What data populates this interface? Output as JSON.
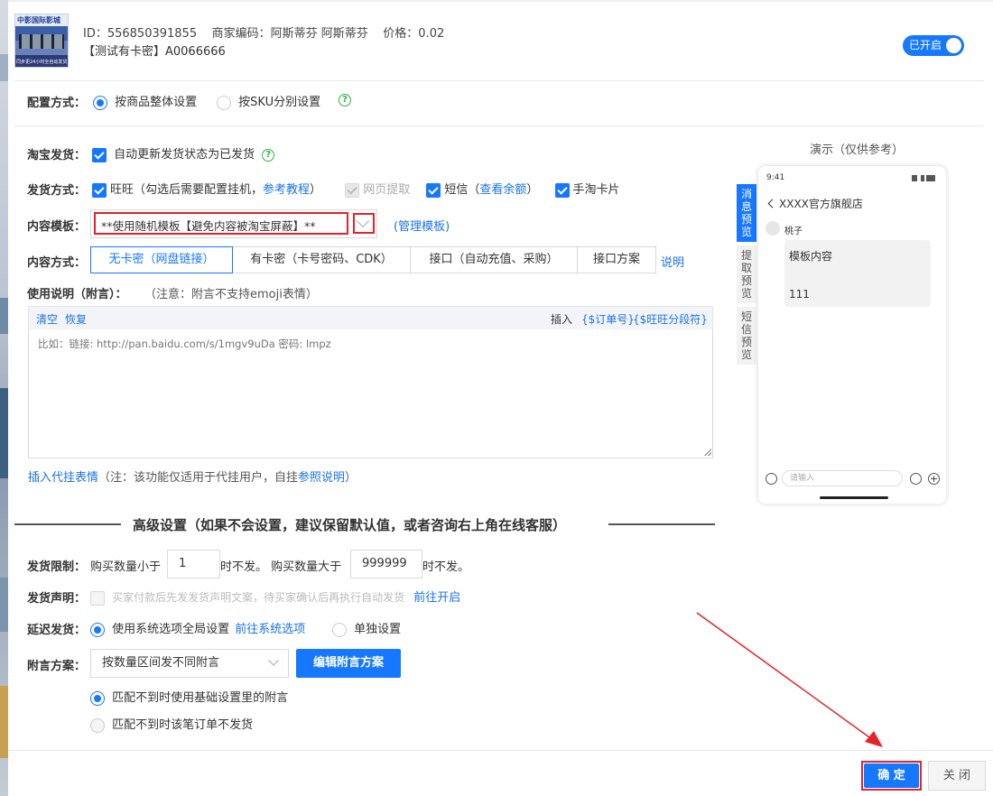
{
  "product": {
    "id_line": "ID：556850391855    商家编码：阿斯蒂芬 阿斯蒂芬    价格：0.02",
    "name": "【测试有卡密】A0066666",
    "thumb_title": "中影国际影城",
    "thumb_sub": "同步更24小时全自动发货",
    "toggle_label": "已开启"
  },
  "config": {
    "label": "配置方式：",
    "options": [
      "按商品整体设置",
      "按SKU分别设置"
    ]
  },
  "taobao": {
    "label": "淘宝发货：",
    "text": "自动更新发货状态为已发货"
  },
  "ship": {
    "label": "发货方式：",
    "wangwang": "旺旺（勾选后需要配置挂机，",
    "wangwang_link": "参考教程",
    "wangwang_end": "）",
    "web": "网页提取",
    "sms": "短信（",
    "sms_link": "查看余额",
    "sms_end": "）",
    "card": "手淘卡片"
  },
  "template": {
    "label": "内容模板：",
    "value": "**使用随机模板【避免内容被淘宝屏蔽】**",
    "manage": "(管理模板)"
  },
  "content": {
    "label": "内容方式：",
    "tabs": [
      "无卡密（网盘链接）",
      "有卡密（卡号密码、CDK）",
      "接口（自动充值、采购）",
      "接口方案"
    ],
    "help": "说明"
  },
  "usage": {
    "label": "使用说明（附言）：",
    "note": "（注意：附言不支持emoji表情）",
    "clear": "清空",
    "restore": "恢复",
    "insert": "插入",
    "tag1": "{$订单号}",
    "tag2": "{$旺旺分段符}",
    "placeholder": "比如：链接: http://pan.baidu.com/s/1mgv9uDa 密码: lmpz",
    "proxy_link": "插入代挂表情",
    "proxy_note": "（注：该功能仅适用于代挂用户，自挂",
    "proxy_ref": "参照说明",
    "proxy_end": "）"
  },
  "advanced": {
    "title": "高级设置（如果不会设置，建议保留默认值，或者咨询右上角在线客服）"
  },
  "limit": {
    "label": "发货限制：",
    "t1": "购买数量小于",
    "v1": "1",
    "t2": "时不发。 购买数量大于",
    "v2": "999999",
    "t3": "时不发。"
  },
  "declare": {
    "label": "发货声明：",
    "text": "买家付款后先发发货声明文案，待买家确认后再执行自动发货",
    "link": "前往开启"
  },
  "delay": {
    "label": "延迟发货：",
    "opt1": "使用系统选项全局设置",
    "link": "前往系统选项",
    "opt2": "单独设置"
  },
  "appendix": {
    "label": "附言方案：",
    "select": "按数量区间发不同附言",
    "button": "编辑附言方案",
    "opt1": "匹配不到时使用基础设置里的附言",
    "opt2": "匹配不到时该笔订单不发货"
  },
  "preview": {
    "title": "演示（仅供参考）",
    "tabs": [
      "消息预览",
      "提取预览",
      "短信预览"
    ],
    "time": "9:41",
    "shop": "XXXX官方旗舰店",
    "user": "桃子",
    "msg_title": "模板内容",
    "msg_body": "111",
    "input_placeholder": "请输入"
  },
  "footer": {
    "confirm": "确 定",
    "close": "关 闭"
  },
  "colors": {
    "accent": "#1677ff",
    "highlight": "#e6222a",
    "help": "#2db34a"
  }
}
